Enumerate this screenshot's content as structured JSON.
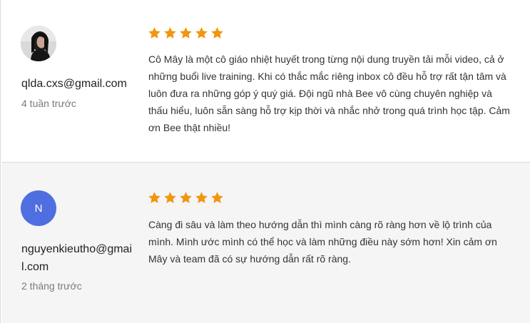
{
  "colors": {
    "star": "#f0960f",
    "avatar_initial_bg": "#4f6fe0",
    "divider": "#dedede",
    "second_row_bg": "#f5f5f5"
  },
  "reviews": [
    {
      "author": "qlda.cxs@gmail.com",
      "time": "4 tuần trước",
      "rating": 5,
      "avatar": "photo",
      "text": "Cô Mây là một cô giáo nhiệt huyết trong từng nội dung truyền tải mỗi video, cả ở những buổi live training. Khi có thắc mắc riêng inbox cô đều hỗ trợ rất tận tâm và luôn đưa ra những góp ý quý giá. Đội ngũ nhà Bee vô cùng chuyên nghiệp và thấu hiểu, luôn sẵn sàng hỗ trợ kịp thời và nhắc nhở trong quá trình học tập. Cảm ơn Bee thật nhiều!"
    },
    {
      "author": "nguyenkieutho@gmail.com",
      "time": "2 tháng trước",
      "rating": 5,
      "avatar_initial": "N",
      "text": "Càng đi sâu và làm theo hướng dẫn thì mình càng rõ ràng hơn về lộ trình của mình. Mình ước mình có thể học và làm những điều này sớm hơn! Xin cảm ơn Mây và team đã có sự hướng dẫn rất rõ ràng."
    }
  ]
}
